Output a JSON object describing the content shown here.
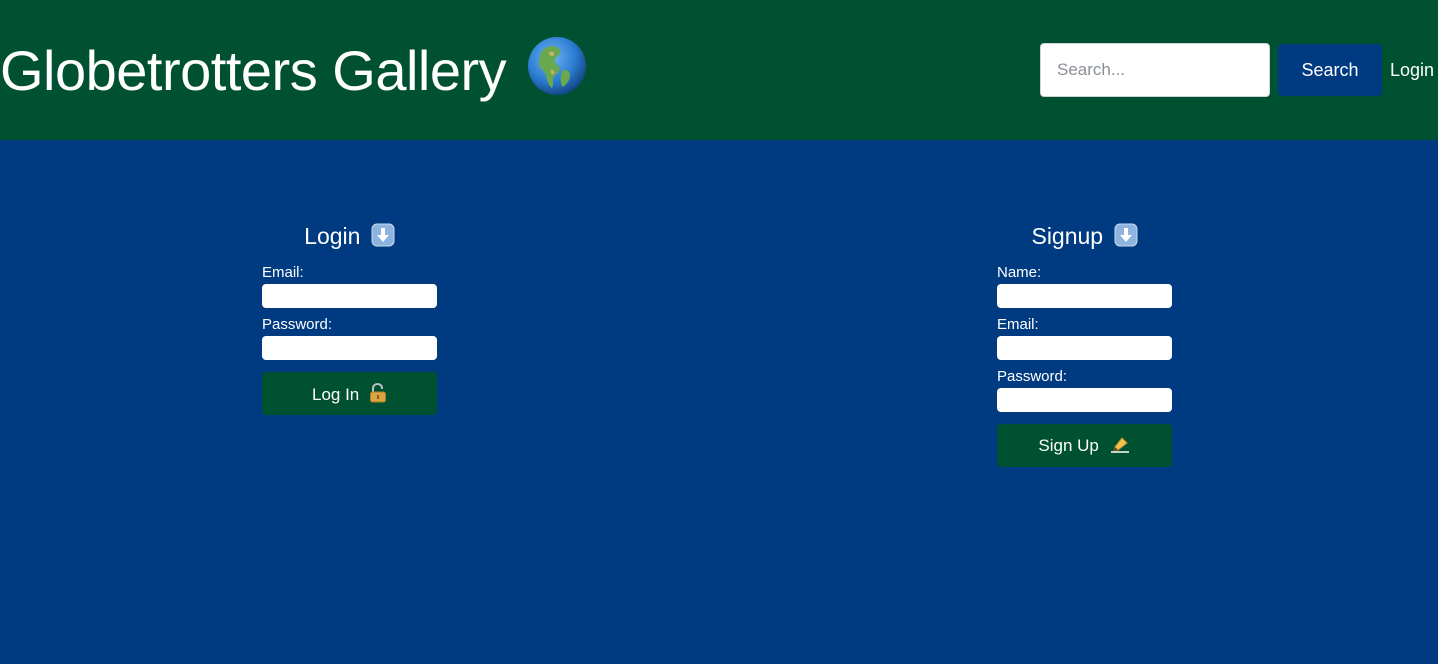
{
  "header": {
    "title": "Globetrotters Gallery",
    "title_icon": "globe-americas-icon",
    "background_color": "#005032",
    "search": {
      "placeholder": "Search...",
      "value": ""
    },
    "search_button_label": "Search",
    "search_button_color": "#003b82",
    "login_link_label": "Login"
  },
  "main": {
    "background_color": "#003b82",
    "login_form": {
      "heading": "Login",
      "heading_icon": "down-arrow-icon",
      "fields": [
        {
          "label": "Email:",
          "value": ""
        },
        {
          "label": "Password:",
          "value": ""
        }
      ],
      "submit_label": "Log In",
      "submit_icon": "unlocked-padlock-icon"
    },
    "signup_form": {
      "heading": "Signup",
      "heading_icon": "down-arrow-icon",
      "fields": [
        {
          "label": "Name:",
          "value": ""
        },
        {
          "label": "Email:",
          "value": ""
        },
        {
          "label": "Password:",
          "value": ""
        }
      ],
      "submit_label": "Sign Up",
      "submit_icon": "writing-hand-icon",
      "button_color": "#005032"
    }
  }
}
